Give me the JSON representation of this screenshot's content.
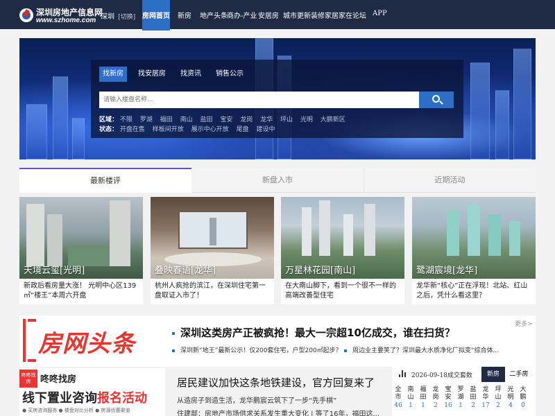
{
  "nav": {
    "logo_cn": "深圳房地产信息网",
    "logo_en": "www.szhome.com",
    "city": "深圳",
    "city_switch": "[切换]",
    "items": [
      "房网首页",
      "新房",
      "地产头条",
      "商办-产业",
      "安居房",
      "城市更新",
      "装修家居",
      "家在论坛",
      "APP"
    ]
  },
  "search": {
    "tabs": [
      "找新房",
      "找安居房",
      "找资讯",
      "销售公示"
    ],
    "placeholder": "请输入楼盘名称...",
    "region_label": "区域：",
    "regions": [
      "不限",
      "罗湖",
      "福田",
      "南山",
      "盐田",
      "宝安",
      "龙岗",
      "龙华",
      "坪山",
      "光明",
      "大鹏新区"
    ],
    "status_label": "状态：",
    "statuses": [
      "开盘在售",
      "样板间开放",
      "展示中心开放",
      "尾盘",
      "建设中"
    ]
  },
  "tabs": [
    "最新楼评",
    "新盘入市",
    "近期活动"
  ],
  "cards": [
    {
      "caption": "天境云玺[光明]",
      "desc": "新政后看房量大涨！ 光明中心区139㎡“楼王”本周六开盘"
    },
    {
      "caption": "叠映春语[龙华]",
      "desc": "杭州人疯抢的滨江，在深圳住宅第一盘取证入市了！"
    },
    {
      "caption": "万星林花园[南山]",
      "desc": "在大南山脚下，看到一个很不一样的高端改善型住宅"
    },
    {
      "caption": "鹭湖宸境[龙华]",
      "desc": "龙华新“核心”正在浮现！北站、红山之后，凭什么看这里？"
    }
  ],
  "headline": {
    "logo": "房网头条",
    "title": "深圳这类房产正被疯抢！最大一宗超10亿成交，谁在扫货？",
    "sub1": "深圳新“地王”最新公示！仅200套住宅，户型200㎡起步？",
    "sub2": "周边业主要笑了？深圳最大水质净化厂拟变“综合体...",
    "more": "更多>"
  },
  "ad": {
    "badge": "咚咚找房",
    "line1": "咚咚找房",
    "line2a": "线下置业咨询",
    "line2b": "报名活动",
    "line3": "● 买房咨询服务   ● 楼盘对比分析   ● 房源优惠渠道"
  },
  "news": {
    "title": "居民建议加快这条地铁建设，官方回复来了",
    "item1": "从造房子到造生活，龙华鹏宸云筑下了一步“先手棋”",
    "item2": "住建部：房地产市场供求关系发生重大变化  |  等了16年，福田这..."
  },
  "stats": {
    "date": "2026-09-18成交套数",
    "tabs": [
      "新房",
      "二手房"
    ],
    "districts": [
      {
        "name": "全市",
        "count": "46"
      },
      {
        "name": "南山",
        "count": "1"
      },
      {
        "name": "福田",
        "count": "1"
      },
      {
        "name": "龙岗",
        "count": "2"
      },
      {
        "name": "宝安",
        "count": "16"
      },
      {
        "name": "罗湖",
        "count": "1"
      },
      {
        "name": "盐田",
        "count": "2"
      },
      {
        "name": "龙华",
        "count": "17"
      },
      {
        "name": "坪山",
        "count": "2"
      },
      {
        "name": "光明",
        "count": "4"
      },
      {
        "name": "大鹏",
        "count": "0"
      }
    ]
  },
  "colors": {
    "nav_bg": "#1f2a44",
    "accent": "#2d6ec6",
    "headline_red": "#e8352e",
    "tab_active_border": "#6a4fbf"
  }
}
